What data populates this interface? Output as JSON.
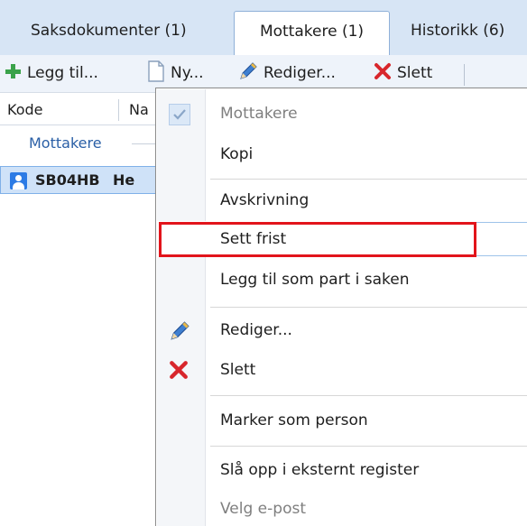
{
  "tabs": [
    {
      "label": "Saksdokumenter (1)"
    },
    {
      "label": "Mottakere (1)",
      "active": true
    },
    {
      "label": "Historikk (6)"
    }
  ],
  "toolbar": {
    "add_label": "Legg til...",
    "new_label": "Ny...",
    "edit_label": "Rediger...",
    "delete_label": "Slett"
  },
  "grid": {
    "columns": [
      "Kode",
      "Na"
    ],
    "group_label": "Mottakere",
    "row": {
      "code": "SB04HB",
      "name": "He"
    }
  },
  "menu": {
    "items": [
      {
        "label": "Mottakere",
        "checked": true,
        "disabled": true
      },
      {
        "label": "Kopi"
      },
      {
        "label": "Avskrivning"
      },
      {
        "label": "Sett frist",
        "highlighted": true
      },
      {
        "label": "Legg til som part i saken"
      },
      {
        "label": "Rediger...",
        "icon": "pencil-icon"
      },
      {
        "label": "Slett",
        "icon": "red-x-icon"
      },
      {
        "label": "Marker som person"
      },
      {
        "label": "Slå opp i eksternt register"
      },
      {
        "label": "Velg e-post",
        "disabled": true
      }
    ]
  },
  "colors": {
    "accent": "#2c7be5",
    "highlight_border": "#e2141b",
    "tabbar_bg": "#d7e5f5"
  }
}
